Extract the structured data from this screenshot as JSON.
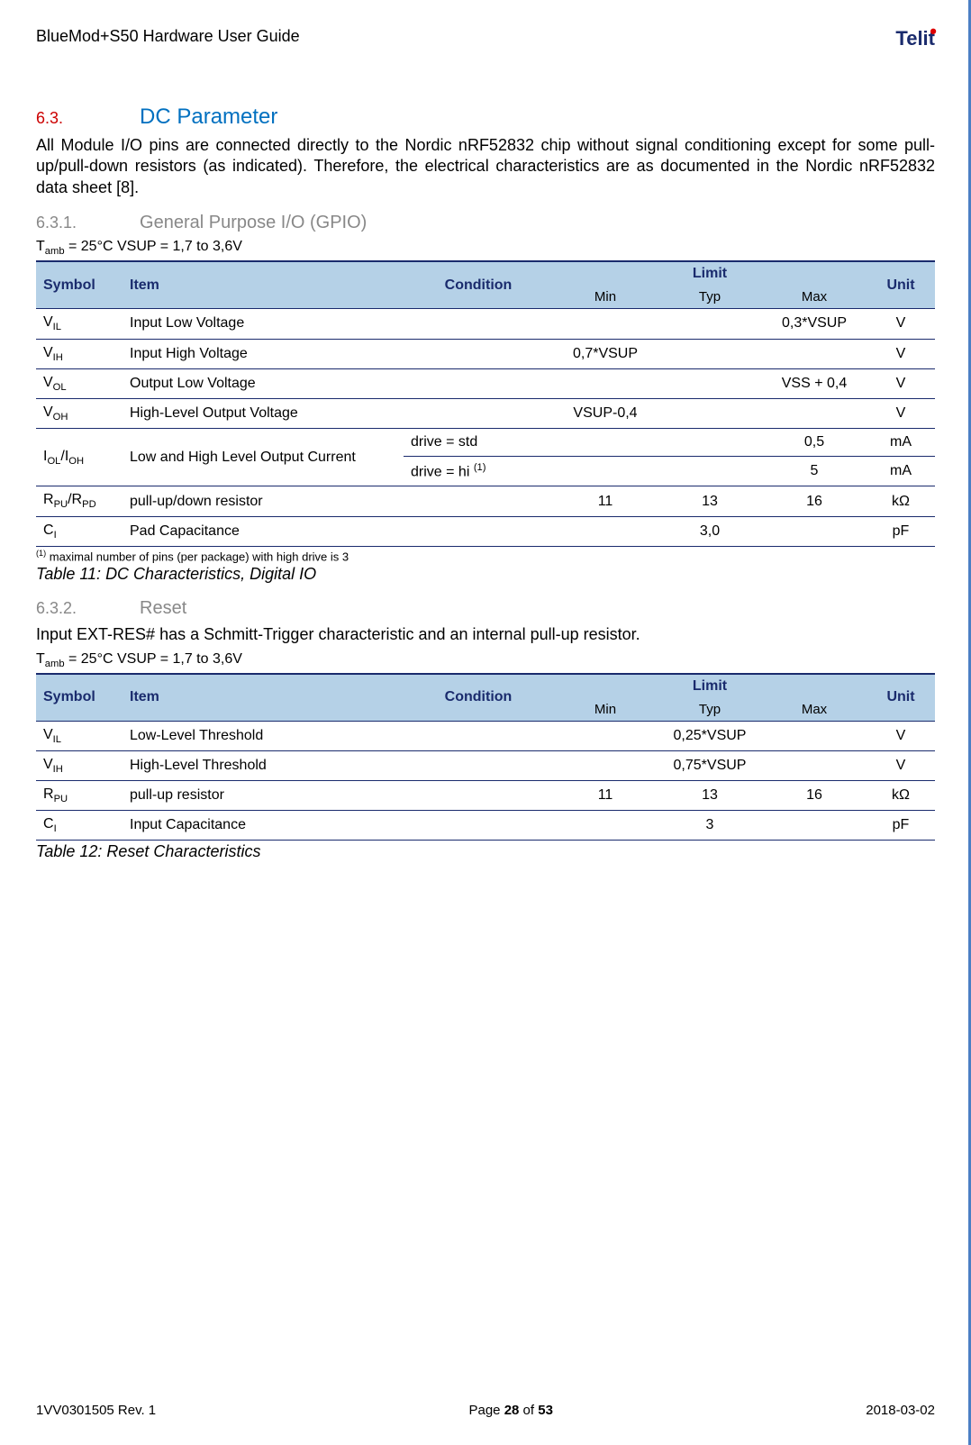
{
  "header": {
    "doc_title": "BlueMod+S50 Hardware User Guide",
    "logo_text": "Telit"
  },
  "section": {
    "num": "6.3.",
    "title": "DC Parameter",
    "body": "All Module I/O pins are connected directly to the Nordic nRF52832 chip without signal conditioning except for some pull-up/pull-down resistors (as indicated). Therefore, the electrical characteristics are as documented in the Nordic nRF52832 data sheet [8]."
  },
  "sub1": {
    "num": "6.3.1.",
    "title": "General Purpose I/O (GPIO)",
    "cond_prefix": "T",
    "cond_sub": "amb",
    "cond_rest": " = 25°C   VSUP = 1,7 to 3,6V",
    "th": {
      "symbol": "Symbol",
      "item": "Item",
      "condition": "Condition",
      "limit": "Limit",
      "min": "Min",
      "typ": "Typ",
      "max": "Max",
      "unit": "Unit"
    },
    "rows": [
      {
        "sym": "V",
        "sub": "IL",
        "item": "Input Low Voltage",
        "cond": "",
        "min": "",
        "typ": "",
        "max": "0,3*VSUP",
        "unit": "V"
      },
      {
        "sym": "V",
        "sub": "IH",
        "item": "Input High Voltage",
        "cond": "",
        "min": "0,7*VSUP",
        "typ": "",
        "max": "",
        "unit": "V"
      },
      {
        "sym": "V",
        "sub": "OL",
        "item": "Output Low Voltage",
        "cond": "",
        "min": "",
        "typ": "",
        "max": "VSS + 0,4",
        "unit": "V"
      },
      {
        "sym": "V",
        "sub": "OH",
        "item": "High-Level Output Voltage",
        "cond": "",
        "min": "VSUP-0,4",
        "typ": "",
        "max": "",
        "unit": "V"
      }
    ],
    "iol": {
      "sym": "I",
      "sub1": "OL",
      "sep": "/I",
      "sub2": "OH",
      "item": "Low and High Level Output Current"
    },
    "iol_r1": {
      "cond": "drive = std",
      "min": "",
      "typ": "",
      "max": "0,5",
      "unit": "mA"
    },
    "iol_r2": {
      "cond_pre": "drive = hi ",
      "cond_sup": "(1)",
      "min": "",
      "typ": "",
      "max": "5",
      "unit": "mA"
    },
    "rpu": {
      "sym": "R",
      "sub1": "PU",
      "sep": "/R",
      "sub2": "PD",
      "item": "pull-up/down resistor",
      "cond": "",
      "min": "11",
      "typ": "13",
      "max": "16",
      "unit": "kΩ"
    },
    "ci": {
      "sym": "C",
      "sub": "I",
      "item": "Pad Capacitance",
      "cond": "",
      "min": "",
      "typ": "3,0",
      "max": "",
      "unit": "pF"
    },
    "footnote_sup": "(1)",
    "footnote": " maximal number of pins (per package) with high drive is 3",
    "caption": "Table 11: DC Characteristics, Digital IO"
  },
  "sub2": {
    "num": "6.3.2.",
    "title": "Reset",
    "body": "Input EXT-RES# has a Schmitt-Trigger characteristic and an internal pull-up resistor.",
    "cond_prefix": "T",
    "cond_sub": "amb",
    "cond_rest": " = 25°C   VSUP = 1,7 to 3,6V",
    "th": {
      "symbol": "Symbol",
      "item": "Item",
      "condition": "Condition",
      "limit": "Limit",
      "min": "Min",
      "typ": "Typ",
      "max": "Max",
      "unit": "Unit"
    },
    "rows": [
      {
        "sym": "V",
        "sub": "IL",
        "item": "Low-Level Threshold",
        "cond": "",
        "min": "",
        "typ": "0,25*VSUP",
        "max": "",
        "unit": "V"
      },
      {
        "sym": "V",
        "sub": "IH",
        "item": "High-Level Threshold",
        "cond": "",
        "min": "",
        "typ": "0,75*VSUP",
        "max": "",
        "unit": "V"
      },
      {
        "sym": "R",
        "sub": "PU",
        "item": "pull-up resistor",
        "cond": "",
        "min": "11",
        "typ": "13",
        "max": "16",
        "unit": "kΩ"
      },
      {
        "sym": "C",
        "sub": "I",
        "item": "Input Capacitance",
        "cond": "",
        "min": "",
        "typ": "3",
        "max": "",
        "unit": "pF"
      }
    ],
    "caption": "Table 12: Reset Characteristics"
  },
  "footer": {
    "left": "1VV0301505 Rev. 1",
    "center_pre": "Page ",
    "center_b": "28",
    "center_post": " of ",
    "center_b2": "53",
    "right": "2018-03-02"
  }
}
